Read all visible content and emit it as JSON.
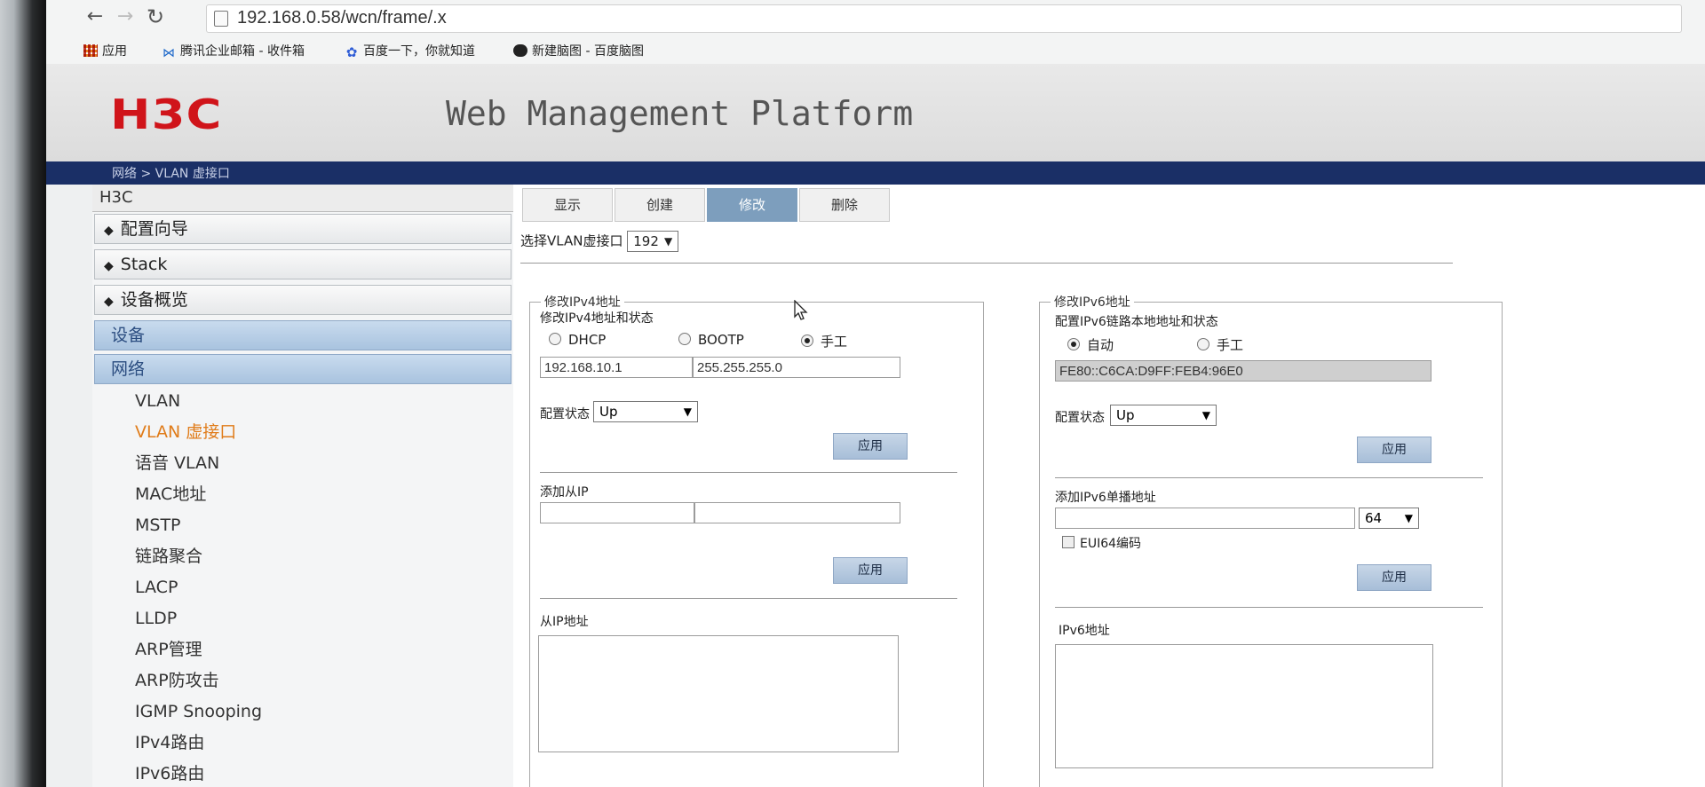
{
  "browser": {
    "url": "192.168.0.58/wcn/frame/.x",
    "bookmarks": [
      "应用",
      "腾讯企业邮箱 - 收件箱",
      "百度一下，你就知道",
      "新建脑图 - 百度脑图"
    ]
  },
  "header": {
    "logo": "H3C",
    "platform_title": "Web Management Platform",
    "breadcrumb": "网络 > VLAN 虚接口"
  },
  "sidebar": {
    "root": "H3C",
    "sections": [
      "配置向导",
      "Stack",
      "设备概览"
    ],
    "groups": [
      "设备",
      "网络"
    ],
    "items": [
      "VLAN",
      "VLAN 虚接口",
      "语音 VLAN",
      "MAC地址",
      "MSTP",
      "链路聚合",
      "LACP",
      "LLDP",
      "ARP管理",
      "ARP防攻击",
      "IGMP Snooping",
      "IPv4路由",
      "IPv6路由"
    ]
  },
  "tabs": [
    "显示",
    "创建",
    "修改",
    "删除"
  ],
  "vlan_select": {
    "label": "选择VLAN虚接口",
    "value": "192"
  },
  "ipv4": {
    "legend": "修改IPv4地址",
    "sub_title": "修改IPv4地址和状态",
    "modes": [
      "DHCP",
      "BOOTP",
      "手工"
    ],
    "selected_mode": "手工",
    "ip": "192.168.10.1",
    "mask": "255.255.255.0",
    "status_label": "配置状态",
    "status_value": "Up",
    "apply": "应用",
    "add_secondary_label": "添加从IP",
    "secondary_list_label": "从IP地址"
  },
  "ipv6": {
    "legend": "修改IPv6地址",
    "sub_title": "配置IPv6链路本地地址和状态",
    "modes": [
      "自动",
      "手工"
    ],
    "selected_mode": "自动",
    "link_local": "FE80::C6CA:D9FF:FEB4:96E0",
    "status_label": "配置状态",
    "status_value": "Up",
    "apply": "应用",
    "add_unicast_label": "添加IPv6单播地址",
    "prefix_len": "64",
    "eui64_label": "EUI64编码",
    "list_label": "IPv6地址"
  }
}
